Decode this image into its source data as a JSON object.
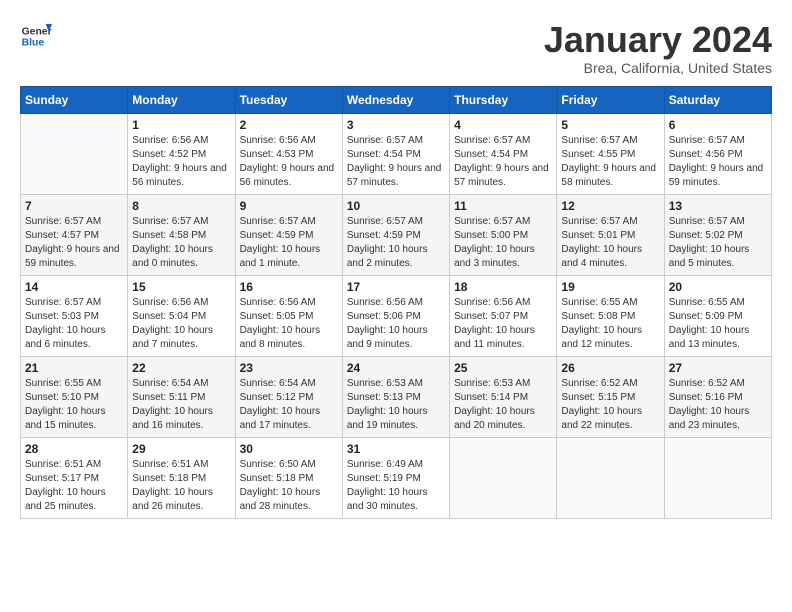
{
  "header": {
    "logo_general": "General",
    "logo_blue": "Blue",
    "month": "January 2024",
    "location": "Brea, California, United States"
  },
  "columns": [
    "Sunday",
    "Monday",
    "Tuesday",
    "Wednesday",
    "Thursday",
    "Friday",
    "Saturday"
  ],
  "weeks": [
    [
      {
        "day": "",
        "sunrise": "",
        "sunset": "",
        "daylight": ""
      },
      {
        "day": "1",
        "sunrise": "Sunrise: 6:56 AM",
        "sunset": "Sunset: 4:52 PM",
        "daylight": "Daylight: 9 hours and 56 minutes."
      },
      {
        "day": "2",
        "sunrise": "Sunrise: 6:56 AM",
        "sunset": "Sunset: 4:53 PM",
        "daylight": "Daylight: 9 hours and 56 minutes."
      },
      {
        "day": "3",
        "sunrise": "Sunrise: 6:57 AM",
        "sunset": "Sunset: 4:54 PM",
        "daylight": "Daylight: 9 hours and 57 minutes."
      },
      {
        "day": "4",
        "sunrise": "Sunrise: 6:57 AM",
        "sunset": "Sunset: 4:54 PM",
        "daylight": "Daylight: 9 hours and 57 minutes."
      },
      {
        "day": "5",
        "sunrise": "Sunrise: 6:57 AM",
        "sunset": "Sunset: 4:55 PM",
        "daylight": "Daylight: 9 hours and 58 minutes."
      },
      {
        "day": "6",
        "sunrise": "Sunrise: 6:57 AM",
        "sunset": "Sunset: 4:56 PM",
        "daylight": "Daylight: 9 hours and 59 minutes."
      }
    ],
    [
      {
        "day": "7",
        "sunrise": "Sunrise: 6:57 AM",
        "sunset": "Sunset: 4:57 PM",
        "daylight": "Daylight: 9 hours and 59 minutes."
      },
      {
        "day": "8",
        "sunrise": "Sunrise: 6:57 AM",
        "sunset": "Sunset: 4:58 PM",
        "daylight": "Daylight: 10 hours and 0 minutes."
      },
      {
        "day": "9",
        "sunrise": "Sunrise: 6:57 AM",
        "sunset": "Sunset: 4:59 PM",
        "daylight": "Daylight: 10 hours and 1 minute."
      },
      {
        "day": "10",
        "sunrise": "Sunrise: 6:57 AM",
        "sunset": "Sunset: 4:59 PM",
        "daylight": "Daylight: 10 hours and 2 minutes."
      },
      {
        "day": "11",
        "sunrise": "Sunrise: 6:57 AM",
        "sunset": "Sunset: 5:00 PM",
        "daylight": "Daylight: 10 hours and 3 minutes."
      },
      {
        "day": "12",
        "sunrise": "Sunrise: 6:57 AM",
        "sunset": "Sunset: 5:01 PM",
        "daylight": "Daylight: 10 hours and 4 minutes."
      },
      {
        "day": "13",
        "sunrise": "Sunrise: 6:57 AM",
        "sunset": "Sunset: 5:02 PM",
        "daylight": "Daylight: 10 hours and 5 minutes."
      }
    ],
    [
      {
        "day": "14",
        "sunrise": "Sunrise: 6:57 AM",
        "sunset": "Sunset: 5:03 PM",
        "daylight": "Daylight: 10 hours and 6 minutes."
      },
      {
        "day": "15",
        "sunrise": "Sunrise: 6:56 AM",
        "sunset": "Sunset: 5:04 PM",
        "daylight": "Daylight: 10 hours and 7 minutes."
      },
      {
        "day": "16",
        "sunrise": "Sunrise: 6:56 AM",
        "sunset": "Sunset: 5:05 PM",
        "daylight": "Daylight: 10 hours and 8 minutes."
      },
      {
        "day": "17",
        "sunrise": "Sunrise: 6:56 AM",
        "sunset": "Sunset: 5:06 PM",
        "daylight": "Daylight: 10 hours and 9 minutes."
      },
      {
        "day": "18",
        "sunrise": "Sunrise: 6:56 AM",
        "sunset": "Sunset: 5:07 PM",
        "daylight": "Daylight: 10 hours and 11 minutes."
      },
      {
        "day": "19",
        "sunrise": "Sunrise: 6:55 AM",
        "sunset": "Sunset: 5:08 PM",
        "daylight": "Daylight: 10 hours and 12 minutes."
      },
      {
        "day": "20",
        "sunrise": "Sunrise: 6:55 AM",
        "sunset": "Sunset: 5:09 PM",
        "daylight": "Daylight: 10 hours and 13 minutes."
      }
    ],
    [
      {
        "day": "21",
        "sunrise": "Sunrise: 6:55 AM",
        "sunset": "Sunset: 5:10 PM",
        "daylight": "Daylight: 10 hours and 15 minutes."
      },
      {
        "day": "22",
        "sunrise": "Sunrise: 6:54 AM",
        "sunset": "Sunset: 5:11 PM",
        "daylight": "Daylight: 10 hours and 16 minutes."
      },
      {
        "day": "23",
        "sunrise": "Sunrise: 6:54 AM",
        "sunset": "Sunset: 5:12 PM",
        "daylight": "Daylight: 10 hours and 17 minutes."
      },
      {
        "day": "24",
        "sunrise": "Sunrise: 6:53 AM",
        "sunset": "Sunset: 5:13 PM",
        "daylight": "Daylight: 10 hours and 19 minutes."
      },
      {
        "day": "25",
        "sunrise": "Sunrise: 6:53 AM",
        "sunset": "Sunset: 5:14 PM",
        "daylight": "Daylight: 10 hours and 20 minutes."
      },
      {
        "day": "26",
        "sunrise": "Sunrise: 6:52 AM",
        "sunset": "Sunset: 5:15 PM",
        "daylight": "Daylight: 10 hours and 22 minutes."
      },
      {
        "day": "27",
        "sunrise": "Sunrise: 6:52 AM",
        "sunset": "Sunset: 5:16 PM",
        "daylight": "Daylight: 10 hours and 23 minutes."
      }
    ],
    [
      {
        "day": "28",
        "sunrise": "Sunrise: 6:51 AM",
        "sunset": "Sunset: 5:17 PM",
        "daylight": "Daylight: 10 hours and 25 minutes."
      },
      {
        "day": "29",
        "sunrise": "Sunrise: 6:51 AM",
        "sunset": "Sunset: 5:18 PM",
        "daylight": "Daylight: 10 hours and 26 minutes."
      },
      {
        "day": "30",
        "sunrise": "Sunrise: 6:50 AM",
        "sunset": "Sunset: 5:18 PM",
        "daylight": "Daylight: 10 hours and 28 minutes."
      },
      {
        "day": "31",
        "sunrise": "Sunrise: 6:49 AM",
        "sunset": "Sunset: 5:19 PM",
        "daylight": "Daylight: 10 hours and 30 minutes."
      },
      {
        "day": "",
        "sunrise": "",
        "sunset": "",
        "daylight": ""
      },
      {
        "day": "",
        "sunrise": "",
        "sunset": "",
        "daylight": ""
      },
      {
        "day": "",
        "sunrise": "",
        "sunset": "",
        "daylight": ""
      }
    ]
  ]
}
